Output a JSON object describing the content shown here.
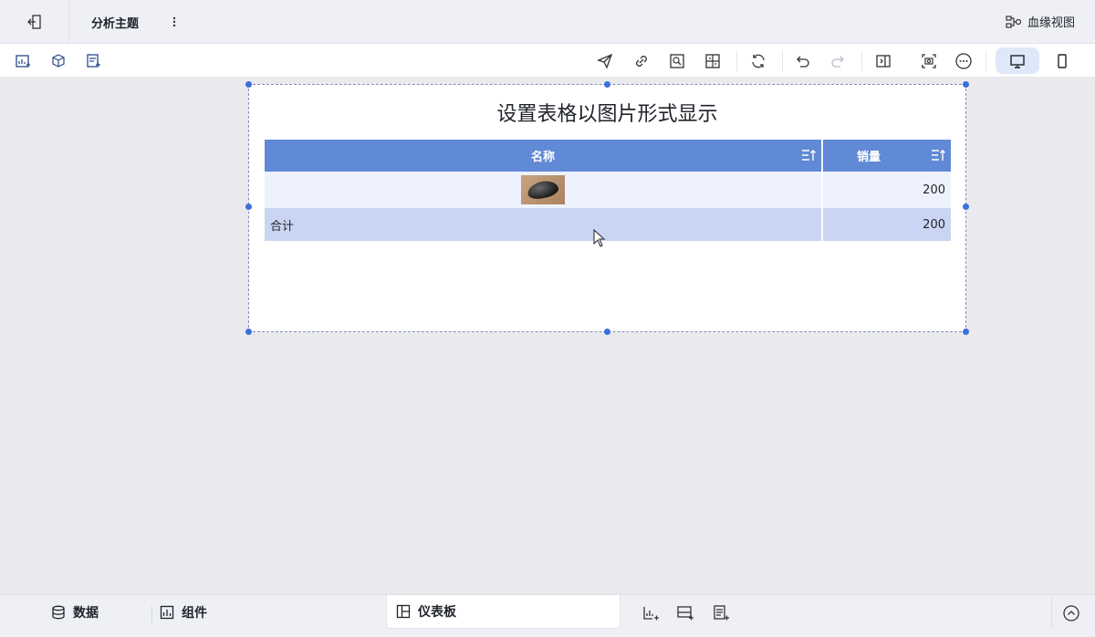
{
  "topbar": {
    "theme_title": "分析主题",
    "lineage_label": "血缘视图"
  },
  "toolbar": {
    "left_icons": [
      "add-chart-icon",
      "add-3d-component-icon",
      "add-text-component-icon"
    ],
    "right_icons": [
      "publish-icon",
      "link-icon",
      "preview-icon",
      "layout-grid-icon",
      "refresh-icon",
      "undo-icon",
      "redo-icon",
      "panel-toggle-icon",
      "screenshot-icon",
      "more-icon"
    ],
    "device_options": [
      "desktop-icon",
      "mobile-icon"
    ]
  },
  "widget": {
    "title": "设置表格以图片形式显示",
    "table": {
      "columns": [
        "名称",
        "销量"
      ],
      "rows": [
        {
          "name_image": "mouse-image",
          "sales": "200"
        }
      ],
      "total": {
        "label": "合计",
        "sales": "200"
      }
    }
  },
  "bottombar": {
    "data_label": "数据",
    "components_label": "组件",
    "dashboard_label": "仪表板"
  },
  "colors": {
    "header_bg": "#6089d6",
    "row_bg": "#eef2fd",
    "total_bg": "#c9d5f2",
    "accent": "#3d6fdb"
  }
}
